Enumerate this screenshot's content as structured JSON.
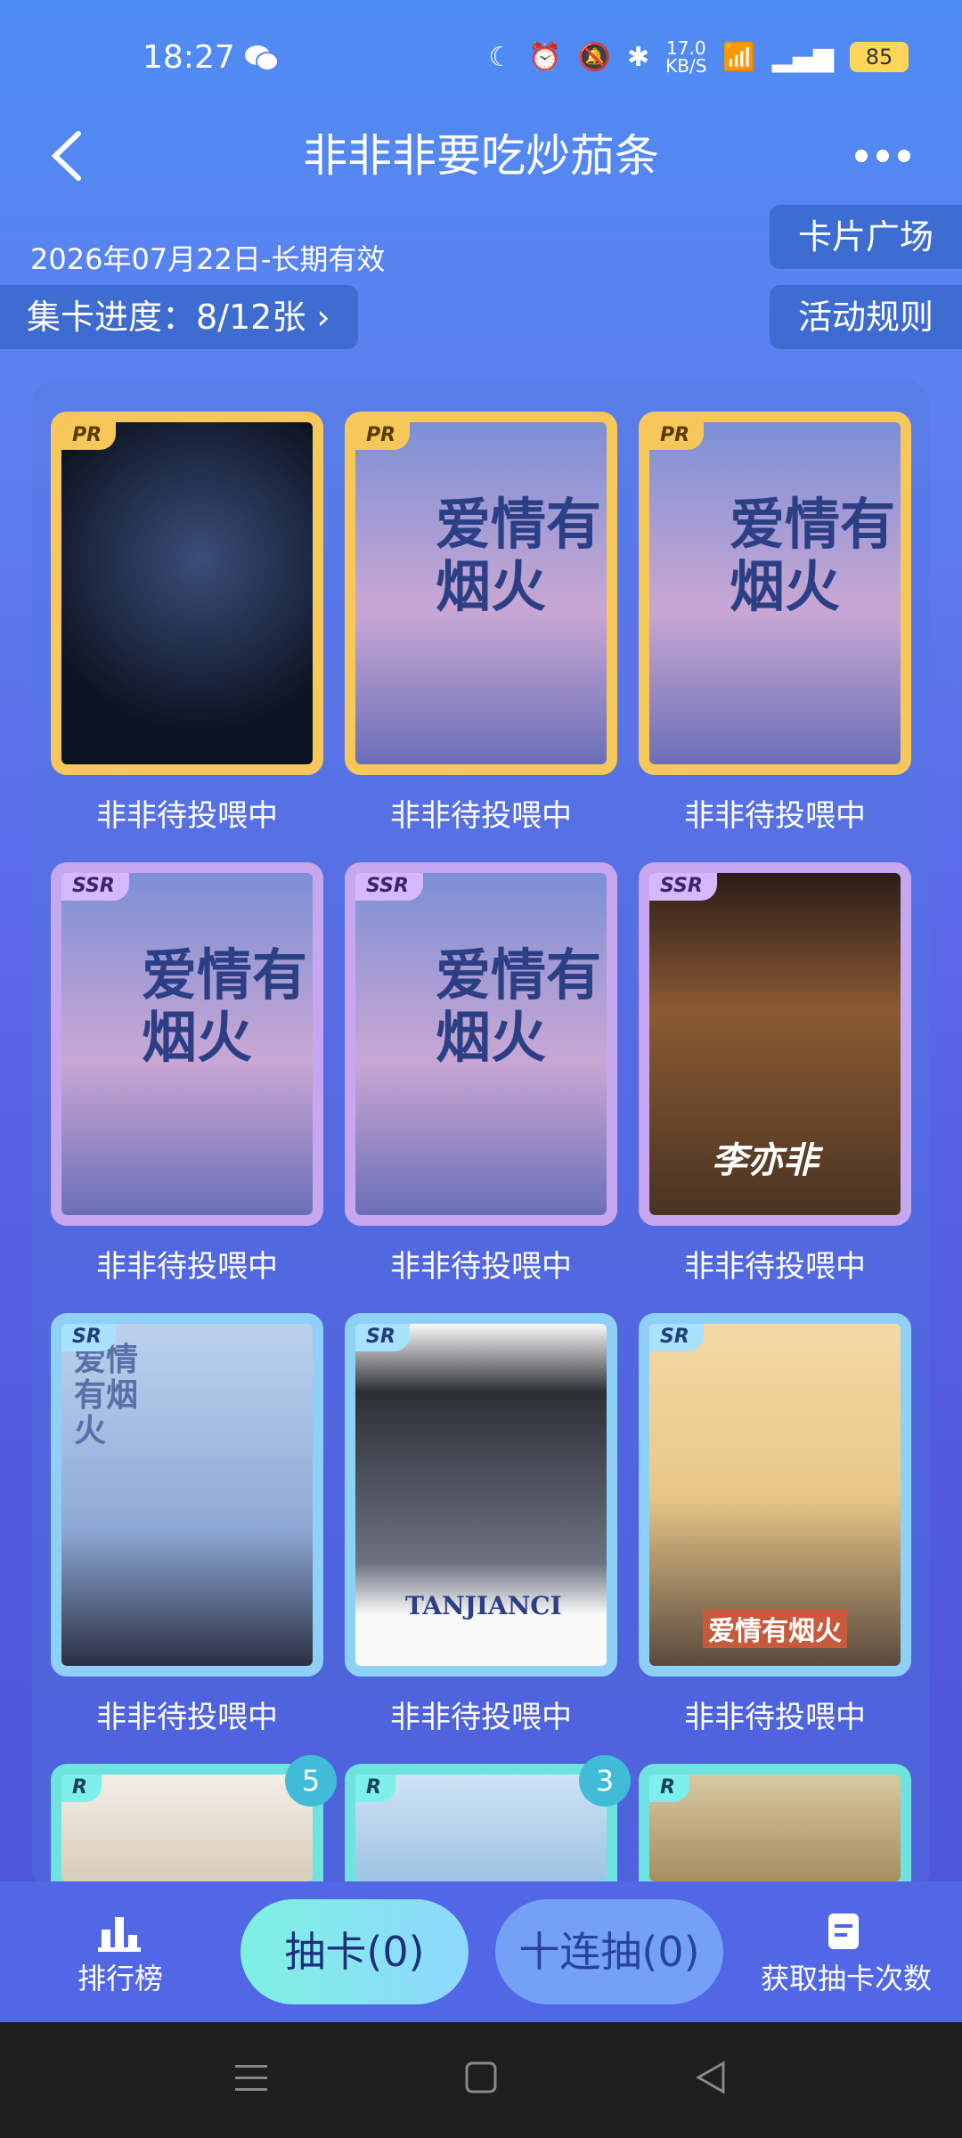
{
  "status": {
    "time": "18:27",
    "network_speed": "17.0",
    "speed_unit": "KB/S",
    "battery": "85"
  },
  "header": {
    "title": "非非非要吃炒茄条",
    "valid": "2026年07月22日-长期有效",
    "progress": "集卡进度：8/12张 ›",
    "square": "卡片广场",
    "rules": "活动规则"
  },
  "cards": [
    {
      "rarity": "PR",
      "caption": "非非待投喂中"
    },
    {
      "rarity": "PR",
      "caption": "非非待投喂中",
      "poster": "爱情有烟火"
    },
    {
      "rarity": "PR",
      "caption": "非非待投喂中",
      "poster": "爱情有烟火"
    },
    {
      "rarity": "SSR",
      "caption": "非非待投喂中",
      "poster": "爱情有烟火"
    },
    {
      "rarity": "SSR",
      "caption": "非非待投喂中",
      "poster": "爱情有烟火"
    },
    {
      "rarity": "SSR",
      "caption": "非非待投喂中",
      "signature": "李亦非"
    },
    {
      "rarity": "SR",
      "caption": "非非待投喂中",
      "poster": "爱情有烟火"
    },
    {
      "rarity": "SR",
      "caption": "非非待投喂中",
      "poster": "TANJIANCI"
    },
    {
      "rarity": "SR",
      "caption": "非非待投喂中",
      "poster": "爱情有烟火"
    },
    {
      "rarity": "R",
      "count": "5"
    },
    {
      "rarity": "R",
      "count": "3"
    },
    {
      "rarity": "R"
    }
  ],
  "bottom": {
    "rank": "排行榜",
    "draw": "抽卡(0)",
    "ten_draw": "十连抽(0)",
    "get_count": "获取抽卡次数"
  }
}
